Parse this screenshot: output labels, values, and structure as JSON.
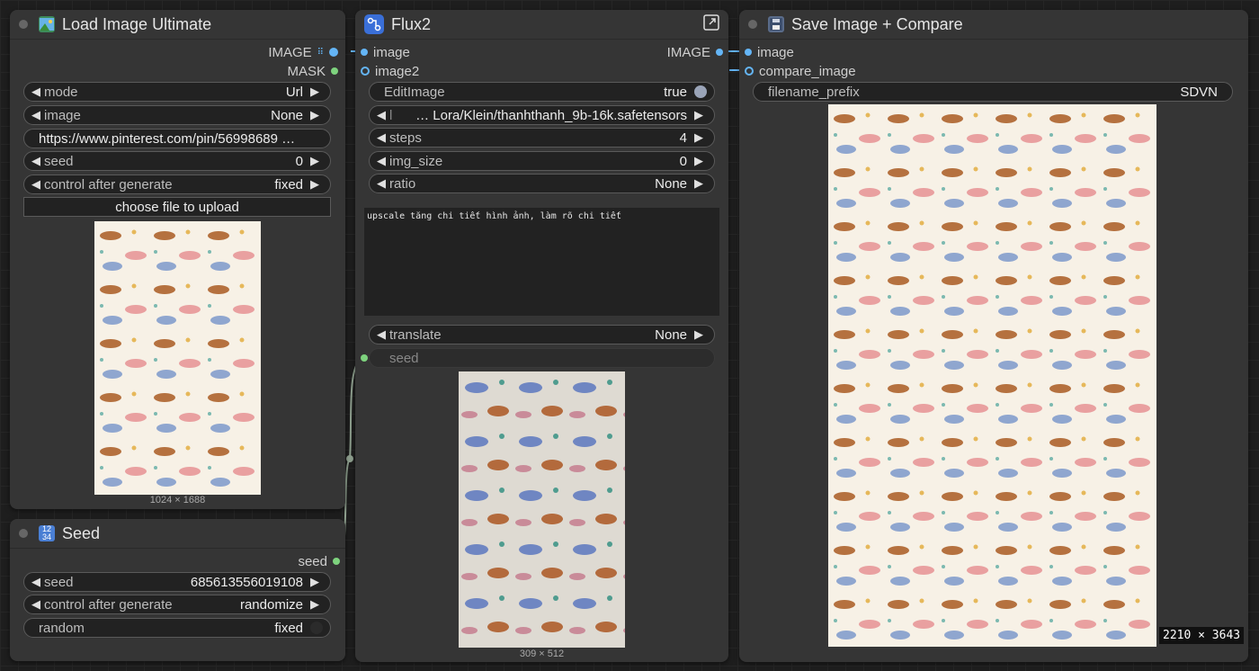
{
  "load_node": {
    "title": "Load Image Ultimate",
    "outputs": {
      "image": "IMAGE",
      "mask": "MASK"
    },
    "mode": {
      "label": "mode",
      "value": "Url"
    },
    "image": {
      "label": "image",
      "value": "None"
    },
    "url": "https://www.pinterest.com/pin/56998689 …",
    "seed": {
      "label": "seed",
      "value": "0"
    },
    "control": {
      "label": "control after generate",
      "value": "fixed"
    },
    "upload_label": "choose file to upload",
    "preview_caption": "1024 × 1688"
  },
  "seed_node": {
    "title": "Seed",
    "output": "seed",
    "seed": {
      "label": "seed",
      "value": "685613556019108"
    },
    "control": {
      "label": "control after generate",
      "value": "randomize"
    },
    "random": {
      "label": "random",
      "value": "fixed"
    }
  },
  "flux_node": {
    "title": "Flux2",
    "inputs": {
      "image": "image",
      "image2": "image2"
    },
    "output": "IMAGE",
    "edit_image": {
      "label": "EditImage",
      "value": "true"
    },
    "lora": {
      "label": "l",
      "value": "… Lora/Klein/thanhthanh_9b-16k.safetensors"
    },
    "steps": {
      "label": "steps",
      "value": "4"
    },
    "img_size": {
      "label": "img_size",
      "value": "0"
    },
    "ratio": {
      "label": "ratio",
      "value": "None"
    },
    "prompt": "upscale tăng chi tiết hình ảnh, làm rõ chi tiết",
    "translate": {
      "label": "translate",
      "value": "None"
    },
    "seed_input": "seed",
    "preview_caption": "309 × 512"
  },
  "save_node": {
    "title": "Save Image + Compare",
    "inputs": {
      "image": "image",
      "compare_image": "compare_image"
    },
    "filename_prefix": {
      "label": "filename_prefix",
      "value": "SDVN"
    },
    "size_label": "2210 × 3643"
  },
  "colors": {
    "image_socket": "#64b5f6",
    "int_socket": "#7ed37e",
    "node_bg": "#353535"
  }
}
